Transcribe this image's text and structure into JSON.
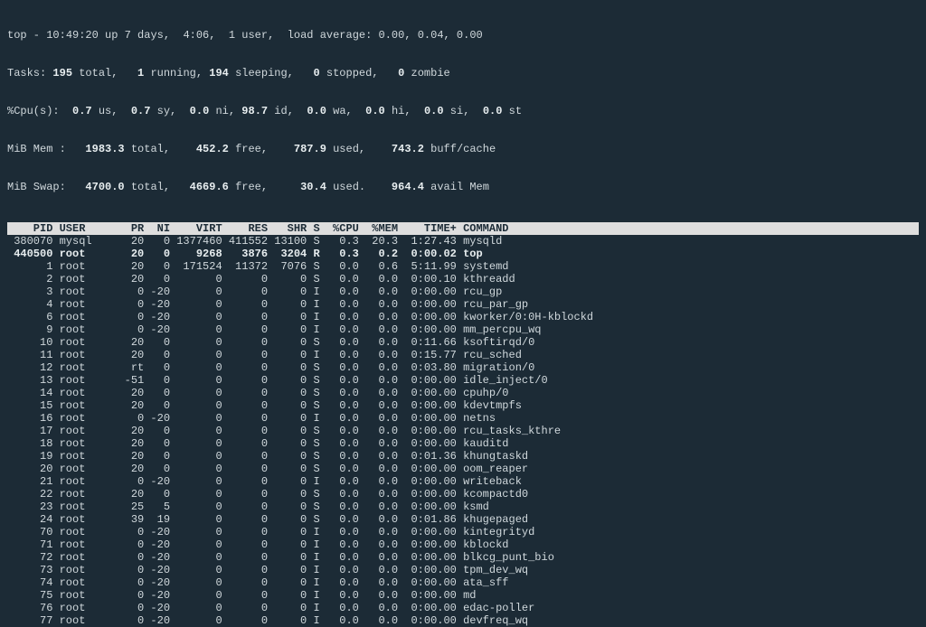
{
  "summary": {
    "line1": {
      "prog": "top",
      "time": "10:49:20",
      "up": "7 days,  4:06",
      "users": "1 user",
      "la": "0.00, 0.04, 0.00"
    },
    "line2": {
      "total": "195",
      "running": "1",
      "sleeping": "194",
      "stopped": "0",
      "zombie": "0"
    },
    "line3": {
      "us": "0.7",
      "sy": "0.7",
      "ni": "0.0",
      "id": "98.7",
      "wa": "0.0",
      "hi": "0.0",
      "si": "0.0",
      "st": "0.0"
    },
    "line4": {
      "total": "1983.3",
      "free": "452.2",
      "used": "787.9",
      "buff": "743.2"
    },
    "line5": {
      "total": "4700.0",
      "free": "4669.6",
      "used": "30.4",
      "avail": "964.4"
    }
  },
  "columns": [
    "PID",
    "USER",
    "PR",
    "NI",
    "VIRT",
    "RES",
    "SHR",
    "S",
    "%CPU",
    "%MEM",
    "TIME+",
    "COMMAND"
  ],
  "processes": [
    {
      "pid": "380070",
      "user": "mysql",
      "pr": "20",
      "ni": "0",
      "virt": "1377460",
      "res": "411552",
      "shr": "13100",
      "s": "S",
      "cpu": "0.3",
      "mem": "20.3",
      "time": "1:27.43",
      "cmd": "mysqld",
      "hl": false
    },
    {
      "pid": "440500",
      "user": "root",
      "pr": "20",
      "ni": "0",
      "virt": "9268",
      "res": "3876",
      "shr": "3204",
      "s": "R",
      "cpu": "0.3",
      "mem": "0.2",
      "time": "0:00.02",
      "cmd": "top",
      "hl": true
    },
    {
      "pid": "1",
      "user": "root",
      "pr": "20",
      "ni": "0",
      "virt": "171524",
      "res": "11372",
      "shr": "7076",
      "s": "S",
      "cpu": "0.0",
      "mem": "0.6",
      "time": "5:11.99",
      "cmd": "systemd",
      "hl": false
    },
    {
      "pid": "2",
      "user": "root",
      "pr": "20",
      "ni": "0",
      "virt": "0",
      "res": "0",
      "shr": "0",
      "s": "S",
      "cpu": "0.0",
      "mem": "0.0",
      "time": "0:00.10",
      "cmd": "kthreadd",
      "hl": false
    },
    {
      "pid": "3",
      "user": "root",
      "pr": "0",
      "ni": "-20",
      "virt": "0",
      "res": "0",
      "shr": "0",
      "s": "I",
      "cpu": "0.0",
      "mem": "0.0",
      "time": "0:00.00",
      "cmd": "rcu_gp",
      "hl": false
    },
    {
      "pid": "4",
      "user": "root",
      "pr": "0",
      "ni": "-20",
      "virt": "0",
      "res": "0",
      "shr": "0",
      "s": "I",
      "cpu": "0.0",
      "mem": "0.0",
      "time": "0:00.00",
      "cmd": "rcu_par_gp",
      "hl": false
    },
    {
      "pid": "6",
      "user": "root",
      "pr": "0",
      "ni": "-20",
      "virt": "0",
      "res": "0",
      "shr": "0",
      "s": "I",
      "cpu": "0.0",
      "mem": "0.0",
      "time": "0:00.00",
      "cmd": "kworker/0:0H-kblockd",
      "hl": false
    },
    {
      "pid": "9",
      "user": "root",
      "pr": "0",
      "ni": "-20",
      "virt": "0",
      "res": "0",
      "shr": "0",
      "s": "I",
      "cpu": "0.0",
      "mem": "0.0",
      "time": "0:00.00",
      "cmd": "mm_percpu_wq",
      "hl": false
    },
    {
      "pid": "10",
      "user": "root",
      "pr": "20",
      "ni": "0",
      "virt": "0",
      "res": "0",
      "shr": "0",
      "s": "S",
      "cpu": "0.0",
      "mem": "0.0",
      "time": "0:11.66",
      "cmd": "ksoftirqd/0",
      "hl": false
    },
    {
      "pid": "11",
      "user": "root",
      "pr": "20",
      "ni": "0",
      "virt": "0",
      "res": "0",
      "shr": "0",
      "s": "I",
      "cpu": "0.0",
      "mem": "0.0",
      "time": "0:15.77",
      "cmd": "rcu_sched",
      "hl": false
    },
    {
      "pid": "12",
      "user": "root",
      "pr": "rt",
      "ni": "0",
      "virt": "0",
      "res": "0",
      "shr": "0",
      "s": "S",
      "cpu": "0.0",
      "mem": "0.0",
      "time": "0:03.80",
      "cmd": "migration/0",
      "hl": false
    },
    {
      "pid": "13",
      "user": "root",
      "pr": "-51",
      "ni": "0",
      "virt": "0",
      "res": "0",
      "shr": "0",
      "s": "S",
      "cpu": "0.0",
      "mem": "0.0",
      "time": "0:00.00",
      "cmd": "idle_inject/0",
      "hl": false
    },
    {
      "pid": "14",
      "user": "root",
      "pr": "20",
      "ni": "0",
      "virt": "0",
      "res": "0",
      "shr": "0",
      "s": "S",
      "cpu": "0.0",
      "mem": "0.0",
      "time": "0:00.00",
      "cmd": "cpuhp/0",
      "hl": false
    },
    {
      "pid": "15",
      "user": "root",
      "pr": "20",
      "ni": "0",
      "virt": "0",
      "res": "0",
      "shr": "0",
      "s": "S",
      "cpu": "0.0",
      "mem": "0.0",
      "time": "0:00.00",
      "cmd": "kdevtmpfs",
      "hl": false
    },
    {
      "pid": "16",
      "user": "root",
      "pr": "0",
      "ni": "-20",
      "virt": "0",
      "res": "0",
      "shr": "0",
      "s": "I",
      "cpu": "0.0",
      "mem": "0.0",
      "time": "0:00.00",
      "cmd": "netns",
      "hl": false
    },
    {
      "pid": "17",
      "user": "root",
      "pr": "20",
      "ni": "0",
      "virt": "0",
      "res": "0",
      "shr": "0",
      "s": "S",
      "cpu": "0.0",
      "mem": "0.0",
      "time": "0:00.00",
      "cmd": "rcu_tasks_kthre",
      "hl": false
    },
    {
      "pid": "18",
      "user": "root",
      "pr": "20",
      "ni": "0",
      "virt": "0",
      "res": "0",
      "shr": "0",
      "s": "S",
      "cpu": "0.0",
      "mem": "0.0",
      "time": "0:00.00",
      "cmd": "kauditd",
      "hl": false
    },
    {
      "pid": "19",
      "user": "root",
      "pr": "20",
      "ni": "0",
      "virt": "0",
      "res": "0",
      "shr": "0",
      "s": "S",
      "cpu": "0.0",
      "mem": "0.0",
      "time": "0:01.36",
      "cmd": "khungtaskd",
      "hl": false
    },
    {
      "pid": "20",
      "user": "root",
      "pr": "20",
      "ni": "0",
      "virt": "0",
      "res": "0",
      "shr": "0",
      "s": "S",
      "cpu": "0.0",
      "mem": "0.0",
      "time": "0:00.00",
      "cmd": "oom_reaper",
      "hl": false
    },
    {
      "pid": "21",
      "user": "root",
      "pr": "0",
      "ni": "-20",
      "virt": "0",
      "res": "0",
      "shr": "0",
      "s": "I",
      "cpu": "0.0",
      "mem": "0.0",
      "time": "0:00.00",
      "cmd": "writeback",
      "hl": false
    },
    {
      "pid": "22",
      "user": "root",
      "pr": "20",
      "ni": "0",
      "virt": "0",
      "res": "0",
      "shr": "0",
      "s": "S",
      "cpu": "0.0",
      "mem": "0.0",
      "time": "0:00.00",
      "cmd": "kcompactd0",
      "hl": false
    },
    {
      "pid": "23",
      "user": "root",
      "pr": "25",
      "ni": "5",
      "virt": "0",
      "res": "0",
      "shr": "0",
      "s": "S",
      "cpu": "0.0",
      "mem": "0.0",
      "time": "0:00.00",
      "cmd": "ksmd",
      "hl": false
    },
    {
      "pid": "24",
      "user": "root",
      "pr": "39",
      "ni": "19",
      "virt": "0",
      "res": "0",
      "shr": "0",
      "s": "S",
      "cpu": "0.0",
      "mem": "0.0",
      "time": "0:01.86",
      "cmd": "khugepaged",
      "hl": false
    },
    {
      "pid": "70",
      "user": "root",
      "pr": "0",
      "ni": "-20",
      "virt": "0",
      "res": "0",
      "shr": "0",
      "s": "I",
      "cpu": "0.0",
      "mem": "0.0",
      "time": "0:00.00",
      "cmd": "kintegrityd",
      "hl": false
    },
    {
      "pid": "71",
      "user": "root",
      "pr": "0",
      "ni": "-20",
      "virt": "0",
      "res": "0",
      "shr": "0",
      "s": "I",
      "cpu": "0.0",
      "mem": "0.0",
      "time": "0:00.00",
      "cmd": "kblockd",
      "hl": false
    },
    {
      "pid": "72",
      "user": "root",
      "pr": "0",
      "ni": "-20",
      "virt": "0",
      "res": "0",
      "shr": "0",
      "s": "I",
      "cpu": "0.0",
      "mem": "0.0",
      "time": "0:00.00",
      "cmd": "blkcg_punt_bio",
      "hl": false
    },
    {
      "pid": "73",
      "user": "root",
      "pr": "0",
      "ni": "-20",
      "virt": "0",
      "res": "0",
      "shr": "0",
      "s": "I",
      "cpu": "0.0",
      "mem": "0.0",
      "time": "0:00.00",
      "cmd": "tpm_dev_wq",
      "hl": false
    },
    {
      "pid": "74",
      "user": "root",
      "pr": "0",
      "ni": "-20",
      "virt": "0",
      "res": "0",
      "shr": "0",
      "s": "I",
      "cpu": "0.0",
      "mem": "0.0",
      "time": "0:00.00",
      "cmd": "ata_sff",
      "hl": false
    },
    {
      "pid": "75",
      "user": "root",
      "pr": "0",
      "ni": "-20",
      "virt": "0",
      "res": "0",
      "shr": "0",
      "s": "I",
      "cpu": "0.0",
      "mem": "0.0",
      "time": "0:00.00",
      "cmd": "md",
      "hl": false
    },
    {
      "pid": "76",
      "user": "root",
      "pr": "0",
      "ni": "-20",
      "virt": "0",
      "res": "0",
      "shr": "0",
      "s": "I",
      "cpu": "0.0",
      "mem": "0.0",
      "time": "0:00.00",
      "cmd": "edac-poller",
      "hl": false
    },
    {
      "pid": "77",
      "user": "root",
      "pr": "0",
      "ni": "-20",
      "virt": "0",
      "res": "0",
      "shr": "0",
      "s": "I",
      "cpu": "0.0",
      "mem": "0.0",
      "time": "0:00.00",
      "cmd": "devfreq_wq",
      "hl": false
    }
  ]
}
